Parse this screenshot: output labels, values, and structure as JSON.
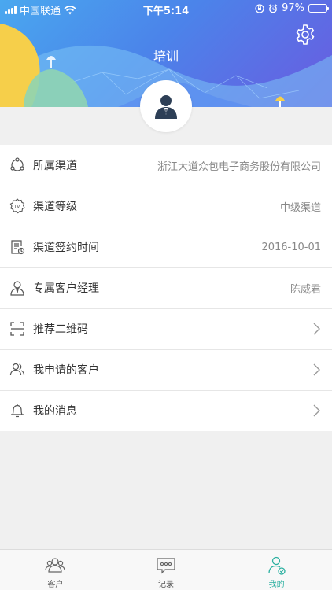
{
  "status_bar": {
    "carrier": "中国联通",
    "time": "下午5:14",
    "battery": "97%",
    "battery_level": 0.97
  },
  "header": {
    "title": "培训"
  },
  "menu": [
    {
      "id": "channel",
      "label": "所属渠道",
      "value": "浙江大道众包电子商务股份有限公司",
      "icon": "channel-share-icon",
      "has_arrow": false
    },
    {
      "id": "level",
      "label": "渠道等级",
      "value": "中级渠道",
      "icon": "level-badge-icon",
      "has_arrow": false
    },
    {
      "id": "sign-date",
      "label": "渠道签约时间",
      "value": "2016-10-01",
      "icon": "contract-clock-icon",
      "has_arrow": false
    },
    {
      "id": "manager",
      "label": "专属客户经理",
      "value": "陈威君",
      "icon": "manager-person-icon",
      "has_arrow": false
    },
    {
      "id": "qrcode",
      "label": "推荐二维码",
      "value": "",
      "icon": "qr-scan-icon",
      "has_arrow": true
    },
    {
      "id": "my-customers",
      "label": "我申请的客户",
      "value": "",
      "icon": "users-icon",
      "has_arrow": true
    },
    {
      "id": "messages",
      "label": "我的消息",
      "value": "",
      "icon": "bell-icon",
      "has_arrow": true
    }
  ],
  "tabbar": {
    "tabs": [
      {
        "label": "客户",
        "icon": "customers-icon"
      },
      {
        "label": "记录",
        "icon": "records-icon"
      },
      {
        "label": "我的",
        "icon": "profile-icon"
      }
    ],
    "active_index": 2
  },
  "colors": {
    "banner_start": "#4aa8ef",
    "banner_end": "#6a5be0",
    "accent": "#2ab0a0",
    "icon_gray": "#555555"
  }
}
